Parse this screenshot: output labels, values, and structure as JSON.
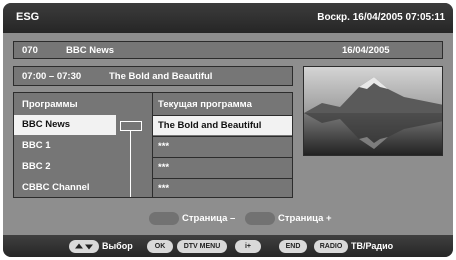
{
  "header": {
    "title": "ESG",
    "datetime": "Воскр.  16/04/2005  07:05:11"
  },
  "channel_bar": {
    "number": "070",
    "name": "BBC News",
    "date": "16/04/2005"
  },
  "program_bar": {
    "time": "07:00 – 07:30",
    "title": "The Bold and Beautiful"
  },
  "list": {
    "left_header": "Программы",
    "right_header": "Текущая программа",
    "channels": [
      "BBC News",
      "BBC 1",
      "BBC 2",
      "CBBC Channel"
    ],
    "programs": [
      "The Bold and Beautiful",
      "***",
      "***",
      "***"
    ]
  },
  "page_nav": {
    "prev_label": "Страница –",
    "next_label": "Страница +"
  },
  "footer": {
    "select_label": "Выбор",
    "ok": "OK",
    "dtv_menu": "DTV MENU",
    "info": "i+",
    "end": "END",
    "radio": "RADIO",
    "tv_radio_label": "ТВ/Радио"
  },
  "colors": {
    "background": "#8e8e8e",
    "panel": "#767676",
    "selected": "#f2f2f2",
    "bar": "#2e2e2e"
  }
}
